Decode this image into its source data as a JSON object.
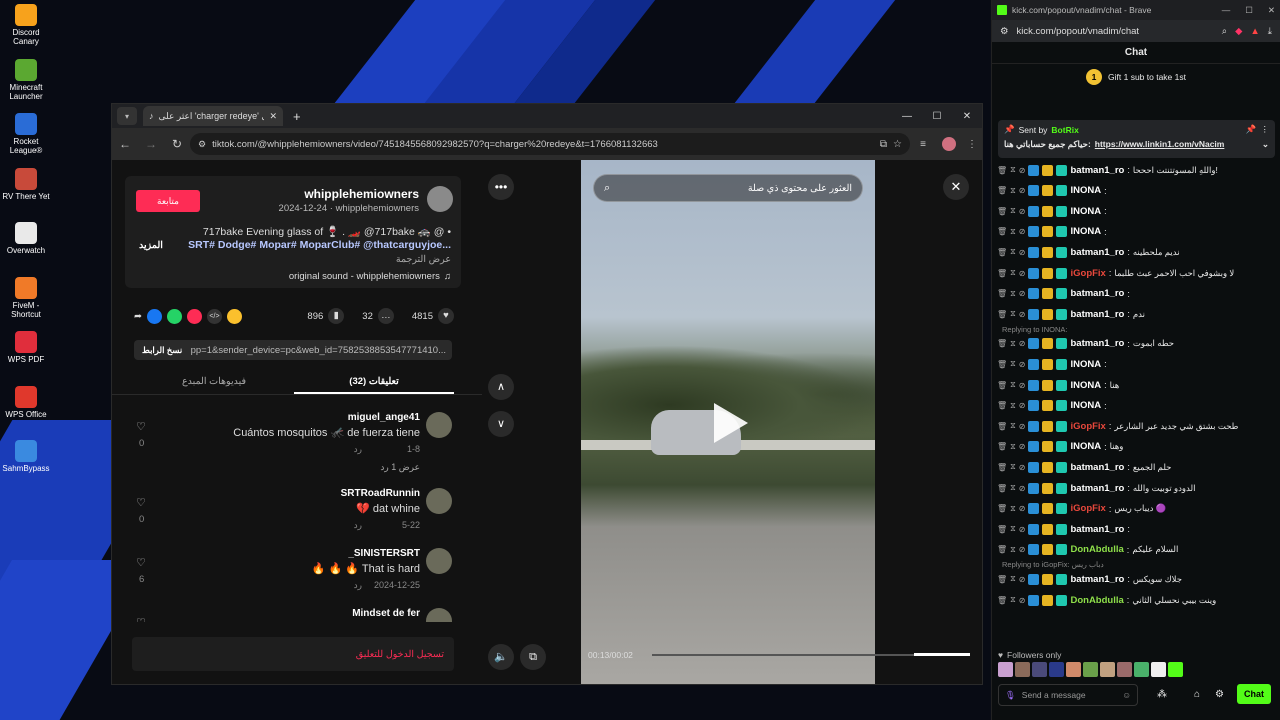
{
  "desktop": {
    "icons": [
      {
        "label": "Discord Canary",
        "color": "#f7a21c"
      },
      {
        "label": "Minecraft Launcher",
        "color": "#5ba831"
      },
      {
        "label": "Rocket League®",
        "color": "#2a6cd6"
      },
      {
        "label": "RV There Yet",
        "color": "#c84a3a"
      },
      {
        "label": "Overwatch",
        "color": "#e9e9e9"
      },
      {
        "label": "FiveM - Shortcut",
        "color": "#f07a28"
      },
      {
        "label": "WPS PDF",
        "color": "#e02e3c"
      },
      {
        "label": "WPS Office",
        "color": "#e0382c"
      },
      {
        "label": "SahmBypass",
        "color": "#3a8ae0"
      }
    ]
  },
  "browser": {
    "tab_title": "اعثر على 'charger redeye' على",
    "url": "tiktok.com/@whipplehemiowners/video/7451845568092982570?q=charger%20redeye&t=1766081132663",
    "post": {
      "username": "whipplehemiowners",
      "meta": "2024-12-24 · whipplehemiowners",
      "follow": "متابعة",
      "caption1": "717bake Evening glass of 🍷 . 🏎️ @717bake 🚓 @ •",
      "caption2": "SRT# Dodge# Mopar# MoparClub# @thatcarguyjoe...",
      "more": "المزيد",
      "translate": "عرض الترجمة",
      "sound": "original sound - whipplehemiowners",
      "likes": "4815",
      "comments": "32",
      "saves": "896",
      "link": "pp=1&sender_device=pc&web_id=7582538853547771410...",
      "copy": "نسخ الرابط",
      "tab_comments": "تعليقات (32)",
      "tab_videos": "فيديوهات المبدع",
      "login": "تسجيل الدخول للتعليق"
    },
    "comments": [
      {
        "user": "miguel_ange41",
        "text": "Cuántos mosquitos 🦟 de fuerza tiene",
        "date": "1-8",
        "reply": "رد",
        "likes": "0",
        "view_replies": "عرض 1 رد"
      },
      {
        "user": "SRTRoadRunnin",
        "text": "💔 dat whine",
        "date": "5-22",
        "reply": "رد",
        "likes": "0"
      },
      {
        "user": "_SINISTERSRT",
        "text": "🔥 🔥 🔥 That is hard",
        "date": "2024-12-25",
        "reply": "رد",
        "likes": "6"
      },
      {
        "user": "Mindset de fer",
        "text": "",
        "date": "",
        "reply": "",
        "likes": ""
      }
    ],
    "video": {
      "search_placeholder": "العثور على محتوى ذي صلة",
      "time": "00:13/00:02"
    }
  },
  "chat": {
    "window_title": "kick.com/popout/vnadim/chat - Brave",
    "url": "kick.com/popout/vnadim/chat",
    "header": "Chat",
    "gift": "Gift 1 sub to take 1st",
    "pinned_by": "Sent by",
    "pinned_bot": "BotRix",
    "pinned_text": "حياكم جميع حساباتي هنا:",
    "pinned_link": "https://www.linkin1.com/vNacim",
    "messages": [
      {
        "user": "batman1_ro",
        "color": "#ffffff",
        "text": "واللهِ المسوتتنتت احححا!"
      },
      {
        "user": "INONA",
        "color": "#ffffff",
        "text": ""
      },
      {
        "user": "INONA",
        "color": "#ffffff",
        "text": ""
      },
      {
        "user": "INONA",
        "color": "#ffffff",
        "text": ""
      },
      {
        "user": "batman1_ro",
        "color": "#ffffff",
        "text": "نديم ملحطينه"
      },
      {
        "user": "iGopFix",
        "color": "#e8483c",
        "text": "لا وبشوفي احب الاحمر عبث طلبما"
      },
      {
        "user": "batman1_ro",
        "color": "#ffffff",
        "text": ""
      },
      {
        "user": "batman1_ro",
        "color": "#ffffff",
        "text": "ندم"
      },
      {
        "user": "batman1_ro",
        "color": "#ffffff",
        "text": "حطه ابموت",
        "reply": "Replying to INONA:"
      },
      {
        "user": "INONA",
        "color": "#ffffff",
        "text": ""
      },
      {
        "user": "INONA",
        "color": "#ffffff",
        "text": "هنا"
      },
      {
        "user": "INONA",
        "color": "#ffffff",
        "text": ""
      },
      {
        "user": "iGopFix",
        "color": "#e8483c",
        "text": "طحت بشتق شي جديد عبر الشارعر"
      },
      {
        "user": "INONA",
        "color": "#ffffff",
        "text": "وهنا"
      },
      {
        "user": "batman1_ro",
        "color": "#ffffff",
        "text": "حلم الجميع"
      },
      {
        "user": "batman1_ro",
        "color": "#ffffff",
        "text": "الدودو توبيت والله"
      },
      {
        "user": "iGopFix",
        "color": "#e8483c",
        "text": "ديباب ريس 🟣"
      },
      {
        "user": "batman1_ro",
        "color": "#ffffff",
        "text": ""
      },
      {
        "user": "DonAbdulla",
        "color": "#8fe04a",
        "text": "السلام عليكم"
      },
      {
        "user": "batman1_ro",
        "color": "#ffffff",
        "text": "جلاك سويكس",
        "reply": "Replying to iGopFix: دباب ريس"
      },
      {
        "user": "DonAbdulla",
        "color": "#8fe04a",
        "text": "وينت بيبي نحسلي الثاني"
      }
    ],
    "followers_only": "Followers only",
    "input_placeholder": "Send a message",
    "send": "Chat"
  }
}
